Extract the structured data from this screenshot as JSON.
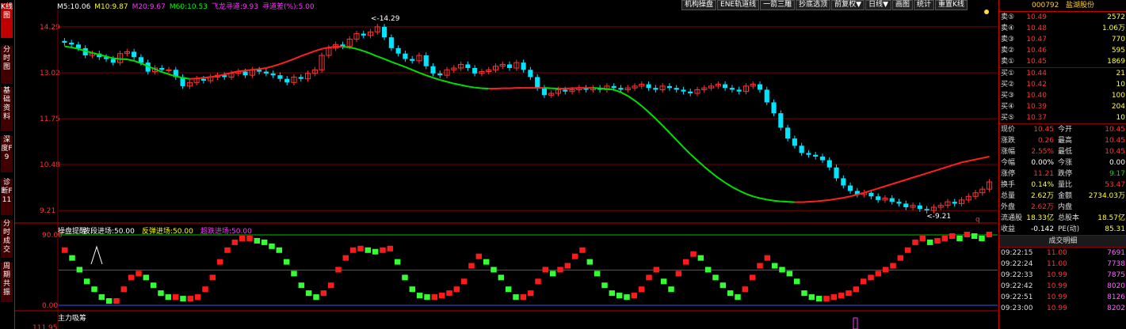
{
  "side_tabs": [
    {
      "label": "K线图",
      "active": true
    },
    {
      "label": "分时图",
      "active": false
    },
    {
      "label": "基础资料",
      "active": false
    },
    {
      "label": "深度F9",
      "active": false
    },
    {
      "label": "诊断F11",
      "active": false
    },
    {
      "label": "分时成交",
      "active": false
    },
    {
      "label": "周期共振",
      "active": false
    }
  ],
  "ma_legend": [
    {
      "text": "M5:10.06",
      "color": "#ffffff"
    },
    {
      "text": "M10:9.87",
      "color": "#ffff00"
    },
    {
      "text": "M20:9.67",
      "color": "#ff33ff"
    },
    {
      "text": "M60:10.53",
      "color": "#00ff00"
    },
    {
      "text": "飞龙寻道:9.93",
      "color": "#ff33ff"
    },
    {
      "text": "寻道差(%):5.00",
      "color": "#ff33ff"
    }
  ],
  "toolbar": [
    "机构操盘",
    "ENE轨道线",
    "一箭三雕",
    "抄底选顶",
    "前复权▼",
    "日线▼",
    "画图",
    "统计",
    "重置K线"
  ],
  "price_axis": {
    "labels": [
      "14.29",
      "13.02",
      "11.75",
      "10.48",
      "9.21"
    ],
    "min": 8.95,
    "max": 14.55
  },
  "annotations": {
    "high": "<-14.29",
    "low": "<-9.21",
    "q": "q"
  },
  "main_chart": {
    "closes": [
      13.85,
      13.8,
      13.7,
      13.5,
      13.55,
      13.45,
      13.4,
      13.3,
      13.55,
      13.6,
      13.45,
      13.3,
      13.05,
      13.15,
      13.1,
      13.1,
      12.9,
      12.65,
      12.75,
      12.85,
      12.8,
      12.9,
      12.95,
      12.9,
      13.0,
      13.05,
      12.95,
      13.1,
      13.05,
      13.0,
      12.95,
      12.85,
      12.75,
      12.9,
      12.85,
      13.0,
      13.1,
      13.5,
      13.7,
      13.8,
      13.75,
      13.95,
      14.1,
      14.05,
      14.15,
      14.29,
      14.0,
      13.7,
      13.55,
      13.4,
      13.35,
      13.5,
      13.2,
      13.0,
      12.95,
      13.1,
      13.15,
      13.25,
      13.15,
      13.0,
      13.05,
      13.1,
      13.2,
      13.25,
      13.15,
      13.3,
      13.1,
      12.9,
      12.6,
      12.4,
      12.45,
      12.55,
      12.5,
      12.55,
      12.6,
      12.55,
      12.6,
      12.55,
      12.65,
      12.6,
      12.55,
      12.6,
      12.65,
      12.7,
      12.6,
      12.55,
      12.65,
      12.6,
      12.55,
      12.5,
      12.45,
      12.55,
      12.6,
      12.65,
      12.7,
      12.6,
      12.55,
      12.5,
      12.65,
      12.7,
      12.55,
      12.2,
      11.9,
      11.5,
      11.2,
      11.0,
      10.8,
      10.75,
      10.7,
      10.6,
      10.4,
      10.1,
      9.9,
      9.75,
      9.65,
      9.7,
      9.6,
      9.5,
      9.55,
      9.45,
      9.4,
      9.3,
      9.35,
      9.25,
      9.21,
      9.3,
      9.35,
      9.45,
      9.4,
      9.5,
      9.6,
      9.7,
      9.8,
      10.0
    ],
    "ma_green": [
      13.75,
      13.72,
      13.68,
      13.62,
      13.57,
      13.52,
      13.47,
      13.42,
      13.4,
      13.39,
      13.35,
      13.28,
      13.2,
      13.12,
      13.04,
      12.98,
      12.92,
      12.88,
      12.85,
      12.86,
      12.88,
      12.9,
      12.93,
      12.97,
      13.02,
      13.06,
      13.08,
      13.1,
      13.12,
      13.15,
      13.2,
      13.26,
      13.33,
      13.4,
      13.48,
      13.55,
      13.62,
      13.68,
      13.72,
      13.74,
      13.74,
      13.72,
      13.68,
      13.62,
      13.55,
      13.47,
      13.4,
      13.32,
      13.25,
      13.18,
      13.1,
      13.02,
      12.95,
      12.88,
      12.82,
      12.77,
      12.72,
      12.68,
      12.64,
      12.61,
      12.59,
      12.58,
      12.58,
      12.59,
      12.59,
      12.6,
      12.6,
      12.6,
      12.6,
      12.6,
      12.59,
      12.58,
      12.58,
      12.59,
      12.6,
      12.6,
      12.6,
      12.59,
      12.57,
      12.55,
      12.48,
      12.38,
      12.25,
      12.1,
      11.93,
      11.75,
      11.56,
      11.36,
      11.16,
      10.96,
      10.77,
      10.59,
      10.42,
      10.26,
      10.11,
      9.98,
      9.86,
      9.76,
      9.67,
      9.6,
      9.55,
      9.51,
      9.48,
      9.46,
      9.45,
      9.44,
      9.44,
      9.45,
      9.46,
      9.48,
      9.5,
      9.53,
      9.56,
      9.6,
      9.65,
      9.7,
      9.76,
      9.82,
      9.88,
      9.94,
      10.0,
      10.06,
      10.12,
      10.18,
      10.24,
      10.3,
      10.36,
      10.42,
      10.48,
      10.54,
      10.58,
      10.62,
      10.66,
      10.7
    ]
  },
  "sub_chart1": {
    "legend": [
      {
        "text": "操盘提醒",
        "color": "#ffffff"
      },
      {
        "text": "波段进场:50.00",
        "color": "#ffffff"
      },
      {
        "text": "反弹进场:50.00",
        "color": "#ffff00"
      },
      {
        "text": "超跌进场:50.00",
        "color": "#ff33ff"
      }
    ],
    "axis": [
      "90.00",
      "0.00"
    ],
    "values": [
      70,
      60,
      45,
      30,
      20,
      10,
      5,
      5,
      20,
      35,
      40,
      35,
      25,
      15,
      10,
      10,
      8,
      8,
      10,
      20,
      35,
      55,
      70,
      80,
      85,
      85,
      82,
      80,
      75,
      70,
      55,
      40,
      25,
      15,
      10,
      15,
      25,
      45,
      60,
      70,
      72,
      70,
      68,
      70,
      72,
      55,
      35,
      20,
      12,
      10,
      10,
      12,
      15,
      20,
      30,
      50,
      62,
      55,
      45,
      35,
      20,
      10,
      10,
      15,
      30,
      45,
      40,
      45,
      50,
      62,
      70,
      55,
      40,
      25,
      15,
      12,
      10,
      12,
      20,
      35,
      45,
      30,
      20,
      40,
      55,
      65,
      60,
      45,
      35,
      25,
      15,
      10,
      20,
      35,
      50,
      60,
      50,
      45,
      40,
      30,
      15,
      10,
      8,
      8,
      10,
      12,
      15,
      20,
      30,
      35,
      40,
      45,
      50,
      60,
      70,
      80,
      85,
      80,
      82,
      85,
      88,
      85,
      90,
      88,
      85,
      90
    ]
  },
  "sub_chart2": {
    "legend": "主力吸筹",
    "axis": "111.95"
  },
  "right_panel": {
    "code": "000792",
    "name": "盐湖股份",
    "sells": [
      {
        "label": "卖⑤",
        "price": "10.49",
        "vol": "2572"
      },
      {
        "label": "卖④",
        "price": "10.48",
        "vol": "1.06万"
      },
      {
        "label": "卖③",
        "price": "10.47",
        "vol": "770"
      },
      {
        "label": "卖②",
        "price": "10.46",
        "vol": "595"
      },
      {
        "label": "卖①",
        "price": "10.45",
        "vol": "1869"
      }
    ],
    "buys": [
      {
        "label": "买①",
        "price": "10.44",
        "vol": "21"
      },
      {
        "label": "买②",
        "price": "10.42",
        "vol": "10"
      },
      {
        "label": "买③",
        "price": "10.40",
        "vol": "100"
      },
      {
        "label": "买④",
        "price": "10.39",
        "vol": "204"
      },
      {
        "label": "买⑤",
        "price": "10.37",
        "vol": "10"
      }
    ],
    "stats": [
      {
        "k1": "现价",
        "v1": "10.45",
        "k2": "今开",
        "v2": "10.45",
        "c1": "red",
        "c2": "red"
      },
      {
        "k1": "涨跌",
        "v1": "0.26",
        "k2": "最高",
        "v2": "10.45",
        "c1": "red",
        "c2": "red"
      },
      {
        "k1": "涨幅",
        "v1": "2.55%",
        "k2": "最低",
        "v2": "10.45",
        "c1": "red",
        "c2": "red"
      },
      {
        "k1": "今幅",
        "v1": "0.00%",
        "k2": "今涨",
        "v2": "0.00",
        "c1": "white",
        "c2": "white"
      },
      {
        "k1": "涨停",
        "v1": "11.21",
        "k2": "跌停",
        "v2": "9.17",
        "c1": "red",
        "c2": "green"
      },
      {
        "k1": "换手",
        "v1": "0.14%",
        "k2": "量比",
        "v2": "53.47",
        "c1": "yel",
        "c2": "red"
      },
      {
        "k1": "总量",
        "v1": "2.62万",
        "k2": "金额",
        "v2": "2734.03万",
        "c1": "yel",
        "c2": "yel"
      },
      {
        "k1": "外盘",
        "v1": "2.62万",
        "k2": "内盘",
        "v2": "",
        "c1": "red",
        "c2": "green"
      },
      {
        "k1": "流通股",
        "v1": "18.33亿",
        "k2": "总股本",
        "v2": "18.57亿",
        "c1": "yel",
        "c2": "yel"
      },
      {
        "k1": "收益",
        "v1": "-0.142",
        "k2": "PE(动)",
        "v2": "85.31",
        "c1": "white",
        "c2": "yel"
      }
    ],
    "trades_title": "成交明细",
    "trades": [
      {
        "time": "09:22:15",
        "price": "11.00",
        "vol": "7691"
      },
      {
        "time": "09:22:24",
        "price": "11.00",
        "vol": "7738"
      },
      {
        "time": "09:22:33",
        "price": "10.99",
        "vol": "7875"
      },
      {
        "time": "09:22:42",
        "price": "10.99",
        "vol": "8020"
      },
      {
        "time": "09:22:51",
        "price": "10.99",
        "vol": "8126"
      },
      {
        "time": "09:23:00",
        "price": "10.99",
        "vol": "8202"
      }
    ]
  }
}
